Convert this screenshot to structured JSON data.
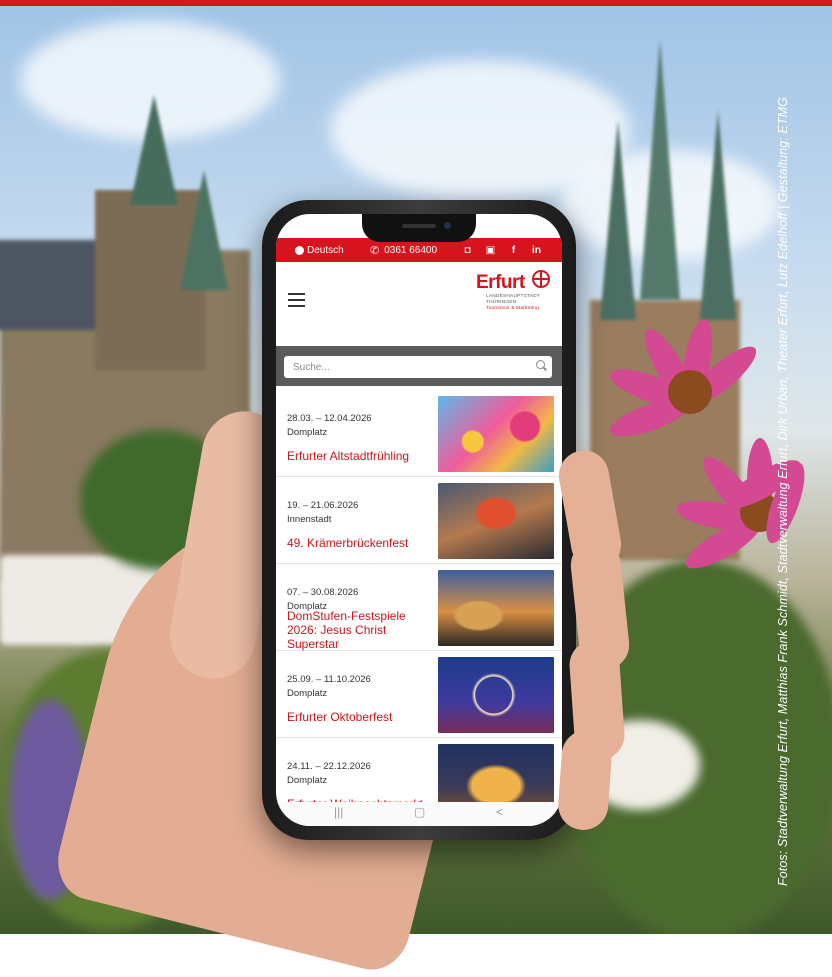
{
  "colors": {
    "brand_red": "#d7141d",
    "title_red": "#c8161d",
    "search_bg": "#5a5a5a"
  },
  "credit": "Fotos: Stadtverwaltung Erfurt, Matthias Frank Schmidt, Stadtverwaltung Erfurt, Dirk Urban, Theater Erfurt, Lutz Edelhoff | Gestaltung: ETMG",
  "utility_bar": {
    "language": "Deutsch",
    "phone": "0361 66400",
    "social_icons": [
      "instagram-icon",
      "youtube-icon",
      "facebook-icon",
      "linkedin-icon"
    ],
    "social_glyphs": [
      "◘",
      "▣",
      "f",
      "in"
    ]
  },
  "header": {
    "logo_word": "Erfurt",
    "logo_sub_1": "LANDESHAUPTSTADT",
    "logo_sub_2": "THÜRINGEN",
    "logo_sub_3": "Tourismus & Marketing"
  },
  "search": {
    "placeholder": "Suche..."
  },
  "events": [
    {
      "date": "28.03. – 12.04.2026",
      "location": "Domplatz",
      "title": "Erfurter Altstadtfrühling"
    },
    {
      "date": "19. – 21.06.2026",
      "location": "Innenstadt",
      "title": "49. Krämerbrückenfest"
    },
    {
      "date": "07. – 30.08.2026",
      "location": "Domplatz",
      "title": "DomStufen-Festspiele 2026: Jesus Christ Superstar"
    },
    {
      "date": "25.09. – 11.10.2026",
      "location": "Domplatz",
      "title": "Erfurter Oktoberfest"
    },
    {
      "date": "24.11. – 22.12.2026",
      "location": "Domplatz",
      "title": "Erfurter Weihnachtsmarkt"
    }
  ],
  "android_nav": {
    "recents": "|||",
    "home": "▢",
    "back": "<"
  }
}
